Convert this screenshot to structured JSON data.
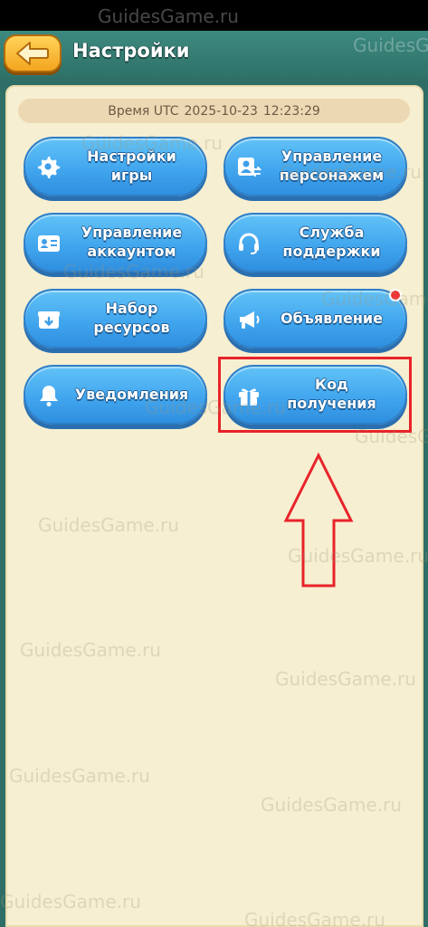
{
  "header": {
    "title": "Настройки",
    "back_icon": "arrow-left-icon"
  },
  "time": {
    "label": "Время UTC",
    "date": "2025-10-23",
    "clock": "12:23:29"
  },
  "buttons": {
    "game_settings": {
      "label": "Настройки\nигры",
      "icon": "gear-icon"
    },
    "character_management": {
      "label": "Управление\nперсонажем",
      "icon": "character-swap-icon"
    },
    "account_management": {
      "label": "Управление\nаккаунтом",
      "icon": "id-card-icon"
    },
    "support": {
      "label": "Служба\nподдержки",
      "icon": "headset-icon"
    },
    "resource_pack": {
      "label": "Набор\nресурсов",
      "icon": "download-box-icon"
    },
    "announcement": {
      "label": "Объявление",
      "icon": "megaphone-icon"
    },
    "notifications": {
      "label": "Уведомления",
      "icon": "bell-icon"
    },
    "redeem_code": {
      "label": "Код\nполучения",
      "icon": "gift-icon"
    }
  },
  "watermark": "GuidesGame.ru",
  "colors": {
    "header": "#2f7168",
    "panel": "#f7efd1",
    "button": "#42a6ee",
    "highlight": "#e8232a"
  }
}
